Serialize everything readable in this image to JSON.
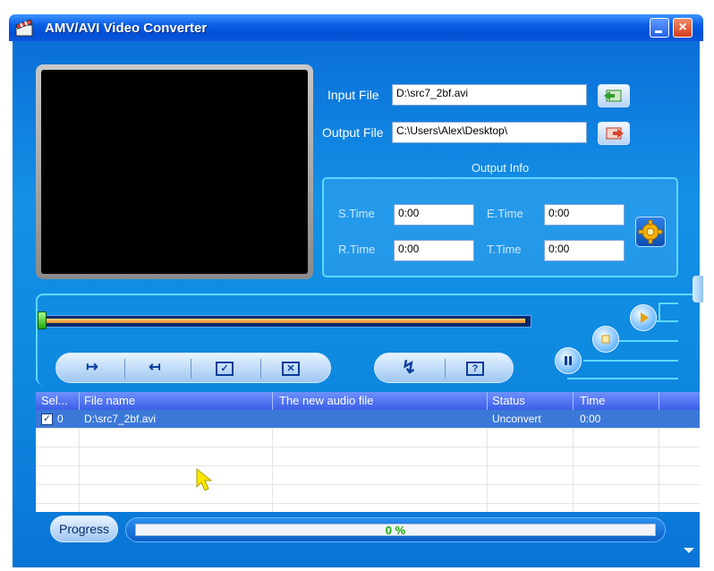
{
  "window": {
    "title": "AMV/AVI Video Converter"
  },
  "io": {
    "input_label": "Input File",
    "input_value": "D:\\src7_2bf.avi",
    "output_label": "Output File",
    "output_value": "C:\\Users\\Alex\\Desktop\\"
  },
  "output_info": {
    "title": "Output Info",
    "s_time_label": "S.Time",
    "s_time": "0:00",
    "e_time_label": "E.Time",
    "e_time": "0:00",
    "r_time_label": "R.Time",
    "r_time": "0:00",
    "t_time_label": "T.Time",
    "t_time": "0:00"
  },
  "file_list": {
    "columns": [
      "Sel...",
      "File name",
      "The new audio file",
      "Status",
      "Time"
    ],
    "rows": [
      {
        "sel": "0",
        "checked": true,
        "file": "D:\\src7_2bf.avi",
        "new_audio": "",
        "status": "Unconvert",
        "time": "0:00"
      }
    ]
  },
  "progress": {
    "button_label": "Progress",
    "text": "0 %",
    "fraction": 0
  },
  "colors": {
    "accent": "#0a74d6",
    "selection": "#3b78d8",
    "progress_text": "#1fa80a"
  }
}
